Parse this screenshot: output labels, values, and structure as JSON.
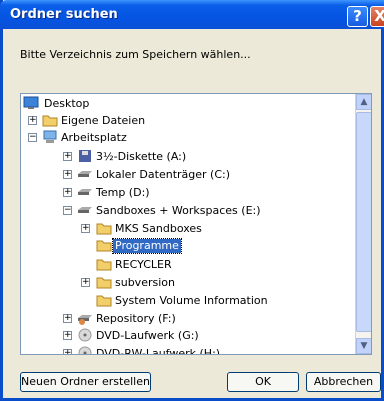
{
  "dialog": {
    "title": "Ordner suchen",
    "description": "Bitte Verzeichnis zum Speichern wählen...",
    "title_buttons": {
      "help": "?",
      "close": "X"
    }
  },
  "tree": {
    "items": [
      {
        "label": "Desktop",
        "icon": "desktop-icon",
        "expander": ""
      },
      {
        "label": "Eigene Dateien",
        "icon": "folder-icon",
        "expander": "+"
      },
      {
        "label": "Arbeitsplatz",
        "icon": "computer-icon",
        "expander": "−"
      },
      {
        "label": "3½-Diskette (A:)",
        "icon": "floppy-icon",
        "expander": "+"
      },
      {
        "label": "Lokaler Datenträger (C:)",
        "icon": "drive-icon",
        "expander": "+"
      },
      {
        "label": "Temp (D:)",
        "icon": "drive-icon",
        "expander": "+"
      },
      {
        "label": "Sandboxes + Workspaces (E:)",
        "icon": "drive-icon",
        "expander": "−"
      },
      {
        "label": "MKS Sandboxes",
        "icon": "folder-icon",
        "expander": "+"
      },
      {
        "label": "Programme",
        "icon": "folder-icon",
        "expander": "",
        "selected": true
      },
      {
        "label": "RECYCLER",
        "icon": "folder-icon",
        "expander": ""
      },
      {
        "label": "subversion",
        "icon": "folder-icon",
        "expander": "+"
      },
      {
        "label": "System Volume Information",
        "icon": "folder-icon",
        "expander": ""
      },
      {
        "label": "Repository (F:)",
        "icon": "drive-icon",
        "expander": "+"
      },
      {
        "label": "DVD-Laufwerk (G:)",
        "icon": "dvd-icon",
        "expander": "+"
      },
      {
        "label": "DVD-RW-Laufwerk (H:)",
        "icon": "dvd-icon",
        "expander": "+"
      }
    ]
  },
  "buttons": {
    "new_folder": "Neuen Ordner erstellen",
    "ok": "OK",
    "cancel": "Abbrechen"
  }
}
